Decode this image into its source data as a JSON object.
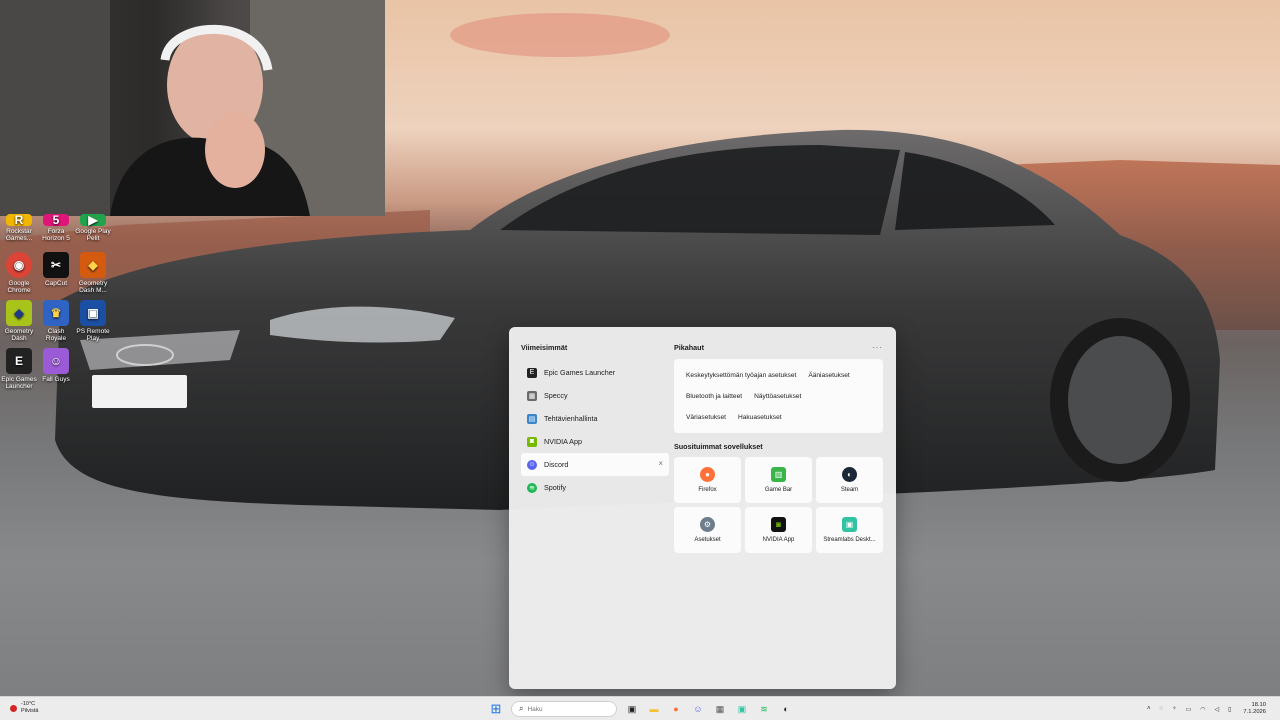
{
  "desktop": {
    "icons": [
      {
        "name": "rockstar-games-launcher",
        "label": "Rockstar Games...",
        "color": "#f2b500",
        "glyph": "R"
      },
      {
        "name": "forza-horizon-5",
        "label": "Forza Horizon 5",
        "color": "#e0157a",
        "glyph": "5"
      },
      {
        "name": "google-play-games",
        "label": "Google Play Pelit",
        "color": "#21a34b",
        "glyph": "▶"
      },
      {
        "name": "google-chrome",
        "label": "Google Chrome",
        "color": "#db4437",
        "glyph": "◉"
      },
      {
        "name": "capcut",
        "label": "CapCut",
        "color": "#111111",
        "glyph": "✂"
      },
      {
        "name": "geometry-dash-meltdown",
        "label": "Geometry Dash M...",
        "color": "#d45a10",
        "glyph": "◆"
      },
      {
        "name": "geometry-dash",
        "label": "Geometry Dash",
        "color": "#a8c41b",
        "glyph": "◆"
      },
      {
        "name": "clash-royale",
        "label": "Clash Royale",
        "color": "#2f63c4",
        "glyph": "♛"
      },
      {
        "name": "ps-remote-play",
        "label": "PS Remote Play",
        "color": "#1b4fa3",
        "glyph": "▣"
      },
      {
        "name": "epic-games-launcher",
        "label": "Epic Games Launcher",
        "color": "#222222",
        "glyph": "E"
      },
      {
        "name": "fall-guys",
        "label": "Fall Guys",
        "color": "#9b5bd6",
        "glyph": "☺"
      }
    ]
  },
  "start_menu": {
    "recent_title": "Viimeisimmät",
    "recent": [
      {
        "label": "Epic Games Launcher",
        "color": "#222222",
        "glyph": "E"
      },
      {
        "label": "Speccy",
        "color": "#6a6a6a",
        "glyph": "▦"
      },
      {
        "label": "Tehtävienhallinta",
        "color": "#3a86c8",
        "glyph": "▤"
      },
      {
        "label": "NVIDIA App",
        "color": "#76b900",
        "glyph": "◙"
      },
      {
        "label": "Discord",
        "color": "#5865f2",
        "glyph": "☺"
      },
      {
        "label": "Spotify",
        "color": "#1db954",
        "glyph": "≋"
      }
    ],
    "remove_glyph": "×",
    "quick_title": "Pikahaut",
    "more_glyph": "···",
    "quick_links": [
      [
        "Keskeytyksettömän työajan asetukset",
        "Ääniasetukset"
      ],
      [
        "Bluetooth ja laitteet",
        "Näyttöasetukset"
      ],
      [
        "Väriasetukset",
        "Hakuasetukset"
      ]
    ],
    "apps_title": "Suosituimmat sovellukset",
    "apps": [
      {
        "label": "Firefox",
        "color": "#ff7139",
        "glyph": "●"
      },
      {
        "label": "Game Bar",
        "color": "#3ab54a",
        "glyph": "▥"
      },
      {
        "label": "Steam",
        "color": "#1b2838",
        "glyph": "◐"
      },
      {
        "label": "Asetukset",
        "color": "#6d7d8c",
        "glyph": "⚙"
      },
      {
        "label": "NVIDIA App",
        "color": "#111111",
        "glyph": "◙"
      },
      {
        "label": "Streamlabs Deskt...",
        "color": "#31c3a2",
        "glyph": "▣"
      }
    ]
  },
  "taskbar": {
    "weather_temp": "-10°C",
    "weather_text": "Pilvistä",
    "start_glyph": "⊞",
    "search_placeholder": "Haku",
    "pinned": [
      {
        "name": "task-view",
        "glyph": "▣",
        "color": "#222222"
      },
      {
        "name": "file-explorer",
        "glyph": "▬",
        "color": "#f2c230"
      },
      {
        "name": "firefox",
        "glyph": "●",
        "color": "#ff7139"
      },
      {
        "name": "discord",
        "glyph": "☺",
        "color": "#5865f2"
      },
      {
        "name": "speccy",
        "glyph": "▦",
        "color": "#555555"
      },
      {
        "name": "streamlabs",
        "glyph": "▣",
        "color": "#31c3a2"
      },
      {
        "name": "spotify",
        "glyph": "≋",
        "color": "#1db954"
      },
      {
        "name": "steam",
        "glyph": "◐",
        "color": "#1b2838"
      }
    ],
    "tray": {
      "chevron": "˄",
      "time": "18.10",
      "date": "7.1.2026"
    }
  }
}
